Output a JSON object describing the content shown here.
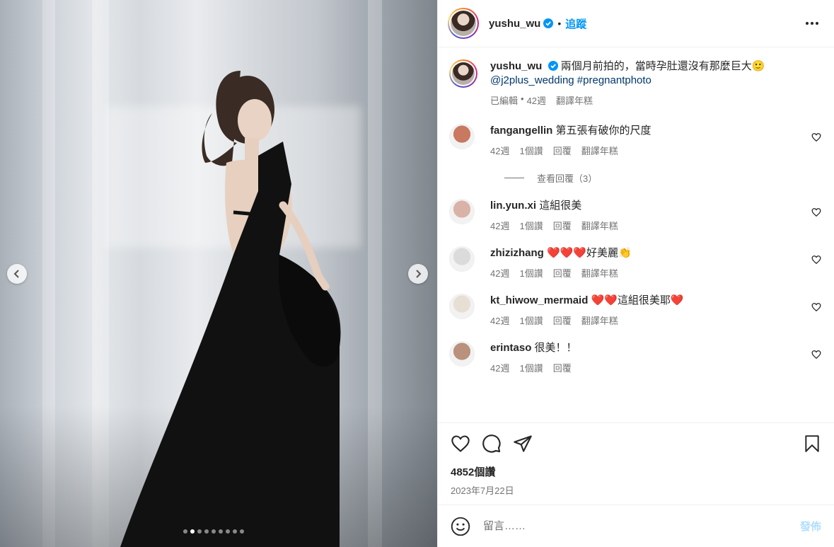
{
  "post": {
    "author": "yushu_wu",
    "follow_label": "追蹤",
    "separator": "•",
    "image_dots": 9,
    "active_dot": 1
  },
  "caption": {
    "username": "yushu_wu",
    "text": "兩個月前拍的，當時孕肚還沒有那麼巨大🙂",
    "tags": "@j2plus_wedding #pregnantphoto",
    "edited": "已編輯",
    "dot": "•",
    "time": "42週",
    "translate": "翻譯年糕"
  },
  "comments": [
    {
      "username": "fangangellin",
      "text": "第五張有破你的尺度",
      "time": "42週",
      "likes": "1個讚",
      "reply": "回覆",
      "translate": "翻譯年糕",
      "avatar_color": "#c8795f"
    },
    {
      "username": "lin.yun.xi",
      "text": "這組很美",
      "time": "42週",
      "likes": "1個讚",
      "reply": "回覆",
      "translate": "翻譯年糕",
      "avatar_color": "#d9b3a8"
    },
    {
      "username": "zhizizhang",
      "text": "❤️❤️❤️好美麗👏",
      "time": "42週",
      "likes": "1個讚",
      "reply": "回覆",
      "translate": "翻譯年糕",
      "avatar_color": "#dbdbdb"
    },
    {
      "username": "kt_hiwow_mermaid",
      "text": "❤️❤️這組很美耶❤️",
      "time": "42週",
      "likes": "1個讚",
      "reply": "回覆",
      "translate": "翻譯年糕",
      "avatar_color": "#e7dfd3"
    },
    {
      "username": "erintaso",
      "text": "很美！！",
      "time": "42週",
      "likes": "1個讚",
      "reply": "回覆",
      "translate": "",
      "avatar_color": "#b9917c"
    }
  ],
  "view_replies": "查看回覆（3）",
  "actions": {
    "likes": "4852個讚",
    "date": "2023年7月22日"
  },
  "composer": {
    "placeholder": "留言……",
    "post_label": "發佈"
  },
  "colors": {
    "accent": "#0095f6",
    "text": "#262626",
    "muted": "#737373",
    "link": "#00376b"
  }
}
